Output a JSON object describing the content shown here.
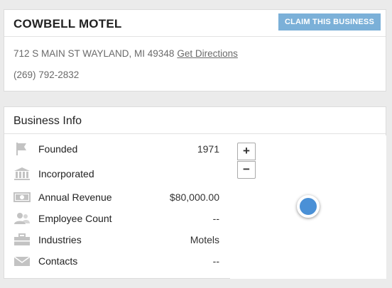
{
  "business": {
    "name": "COWBELL MOTEL",
    "claim_label": "CLAIM THIS BUSINESS",
    "address": "712 S MAIN ST WAYLAND, MI 49348",
    "directions_label": "Get Directions",
    "phone": "(269) 792-2832"
  },
  "info": {
    "title": "Business Info",
    "rows": [
      {
        "icon": "flag-icon",
        "label": "Founded",
        "value": "1971"
      },
      {
        "icon": "building-icon",
        "label": "Incorporated",
        "value": ""
      },
      {
        "icon": "money-icon",
        "label": "Annual Revenue",
        "value": "$80,000.00"
      },
      {
        "icon": "people-icon",
        "label": "Employee Count",
        "value": "--"
      },
      {
        "icon": "briefcase-icon",
        "label": "Industries",
        "value": "Motels"
      },
      {
        "icon": "envelope-icon",
        "label": "Contacts",
        "value": "--"
      }
    ]
  },
  "map": {
    "zoom_in": "+",
    "zoom_out": "−",
    "marker_color": "#4a90d6"
  },
  "colors": {
    "claim_button": "#7bb0d8",
    "icon_gray": "#c3c3c3"
  }
}
